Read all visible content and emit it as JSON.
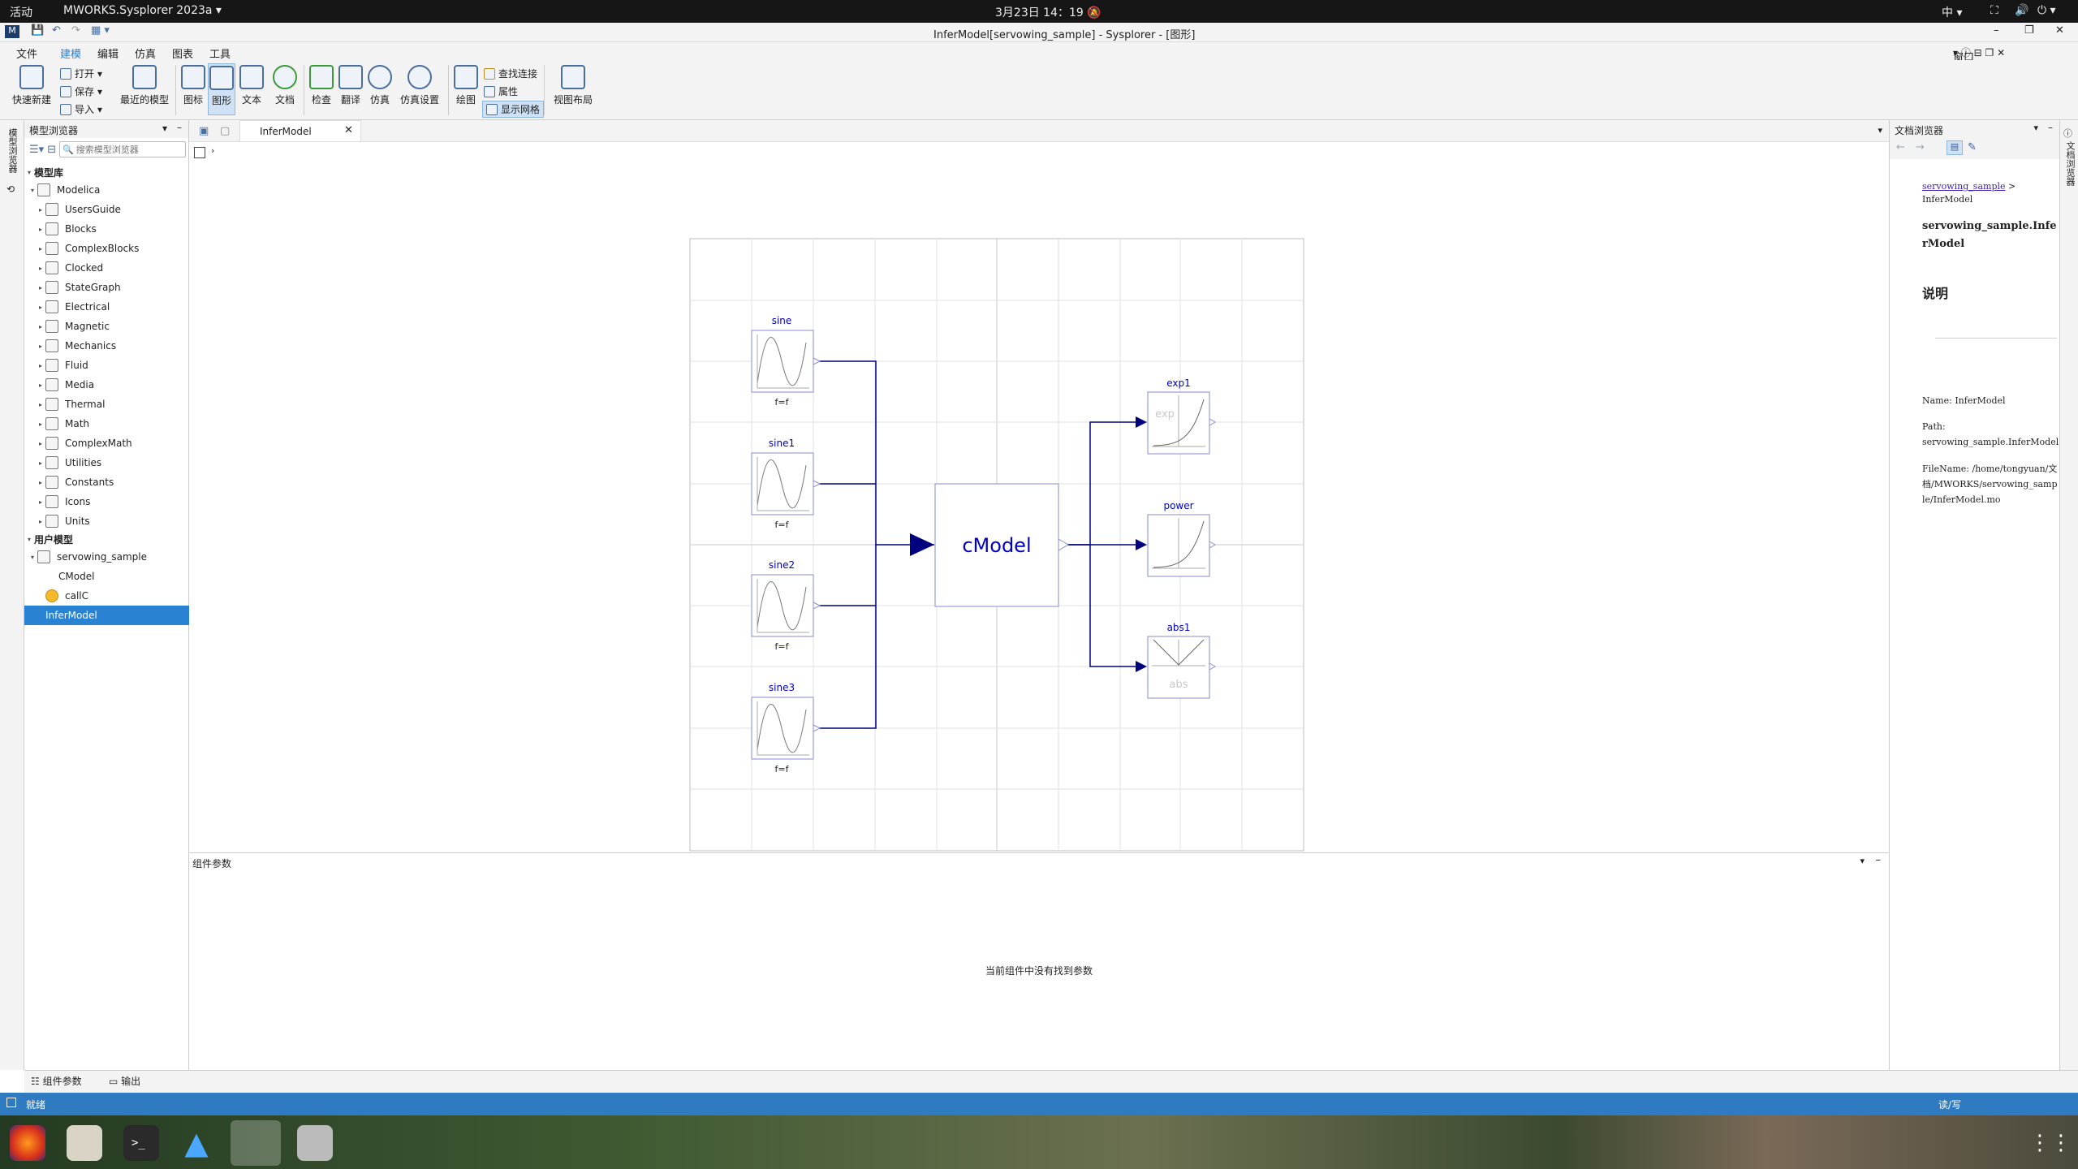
{
  "topbar": {
    "activities": "活动",
    "app": "MWORKS.Sysplorer 2023a",
    "clock": "3月23日 14：19",
    "ime": "中"
  },
  "window": {
    "title": "InferModel[servowing_sample] - Sysplorer - [图形]"
  },
  "menu": {
    "file": "文件",
    "model": "建模",
    "edit": "编辑",
    "sim": "仿真",
    "chart": "图表",
    "tools": "工具",
    "window": "窗口"
  },
  "ribbon": {
    "quick_new": "快速新建",
    "open": "打开",
    "save": "保存",
    "import": "导入",
    "recent": "最近的模型",
    "icon": "图标",
    "diagram": "图形",
    "text": "文本",
    "doc": "文档",
    "check": "检查",
    "translate": "翻译",
    "simulate": "仿真",
    "sim_settings": "仿真设置",
    "plot": "绘图",
    "find_conn": "查找连接",
    "props": "属性",
    "show_grid": "显示网格",
    "view_layout": "视图布局"
  },
  "left": {
    "panel_title": "模型浏览器",
    "search_placeholder": "搜索模型浏览器",
    "side_tab": "模型浏览器",
    "lib_header": "模型库",
    "user_header": "用户模型",
    "lib": [
      "Modelica",
      "UsersGuide",
      "Blocks",
      "ComplexBlocks",
      "Clocked",
      "StateGraph",
      "Electrical",
      "Magnetic",
      "Mechanics",
      "Fluid",
      "Media",
      "Thermal",
      "Math",
      "ComplexMath",
      "Utilities",
      "Constants",
      "Icons",
      "Units"
    ],
    "user": [
      "servowing_sample",
      "CModel",
      "callC",
      "InferModel"
    ]
  },
  "center": {
    "tab": "InferModel"
  },
  "diagram": {
    "sine": "sine",
    "sine1": "sine1",
    "sine2": "sine2",
    "sine3": "sine3",
    "param": "f=f",
    "cmodel": "cModel",
    "exp1": "exp1",
    "exp_text": "exp",
    "power": "power",
    "abs1": "abs1",
    "abs_text": "abs"
  },
  "params": {
    "title": "组件参数",
    "empty": "当前组件中没有找到参数"
  },
  "right": {
    "title": "文档浏览器",
    "side_tab": "文档浏览器",
    "crumb_link": "servowing_sample",
    "crumb_rest": " > InferModel",
    "heading": "servowing_sample.InferModel",
    "desc": "说明",
    "name": "Name: InferModel",
    "path": "Path: servowing_sample.InferModel",
    "filename": "FileName: /home/tongyuan/文档/MWORKS/servowing_sample/InferModel.mo"
  },
  "bottom": {
    "tab_params": "组件参数",
    "tab_output": "输出"
  },
  "status": {
    "left": "就绪",
    "right": "读/写"
  },
  "colors": {
    "accent": "#2a82d2",
    "diagram_blue": "#0000c8",
    "wire": "#00007f"
  }
}
